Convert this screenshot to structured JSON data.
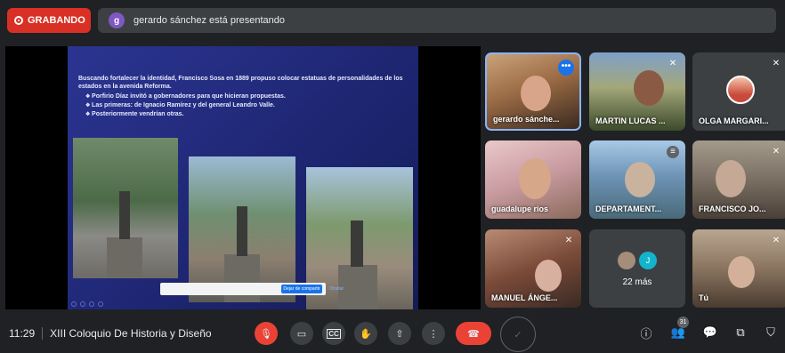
{
  "recording": {
    "label": "GRABANDO"
  },
  "presenter": {
    "avatar_letter": "g",
    "text": "gerardo sánchez está presentando"
  },
  "slide": {
    "paragraph": "Buscando fortalecer la identidad, Francisco Sosa en 1889 propuso colocar estatuas de personalidades de los estados en la avenida Reforma.",
    "bullets": [
      "Porfirio Díaz invitó a gobernadores para que hicieran propuestas.",
      "Las primeras: de Ignacio Ramírez y del general Leandro Valle.",
      "Posteriormente vendrían otras."
    ],
    "stop_share_label": "Dejar de compartir",
    "hide_label": "Ocultar"
  },
  "participants": [
    {
      "name": "gerardo sánche...",
      "muted": false
    },
    {
      "name": "MARTIN LUCAS ...",
      "muted": true
    },
    {
      "name": "OLGA MARGARI...",
      "muted": true
    },
    {
      "name": "guadalupe rios",
      "muted": false
    },
    {
      "name": "DEPARTAMENT...",
      "muted": false
    },
    {
      "name": "FRANCISCO JO...",
      "muted": true
    },
    {
      "name": "MANUEL ÁNGE...",
      "muted": true
    },
    {
      "name": "Tú",
      "muted": true
    }
  ],
  "more": {
    "count_label": "22 más",
    "avatar_letter": "J"
  },
  "bottom": {
    "time": "11:29",
    "meeting_title": "XIII Coloquio De Historia y Diseño",
    "people_count": "31"
  },
  "colors": {
    "accent": "#1a73e8",
    "recording": "#d93025",
    "hangup": "#ea4335",
    "bar": "#202124"
  }
}
